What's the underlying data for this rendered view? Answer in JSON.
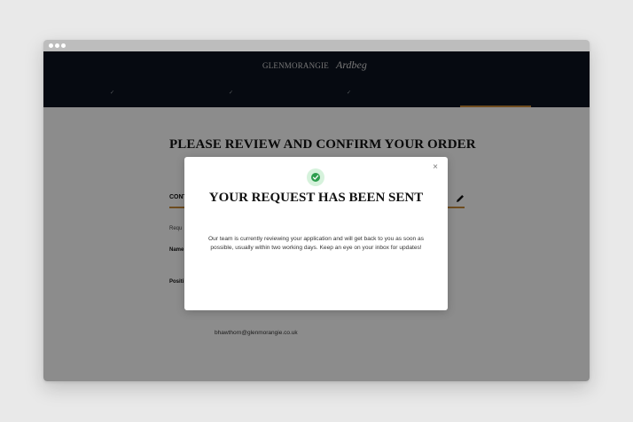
{
  "header": {
    "brand_primary": "GLENMORANGIE",
    "brand_secondary": "Ardbeg",
    "step_check": "✓"
  },
  "page": {
    "title": "PLEASE REVIEW AND CONFIRM YOUR ORDER",
    "section_heading": "CONT",
    "required_text": "Requ",
    "name_label": "Name",
    "position_label": "Positi",
    "email_value": "bhawthorn@glenmorangie.co.uk"
  },
  "modal": {
    "close_label": "×",
    "title": "YOUR REQUEST HAS BEEN SENT",
    "body": "Our team is currently reviewing your application and will get back to you as soon as possible, usually within two working days. Keep an eye on your inbox for updates!"
  },
  "colors": {
    "header_bg": "#0c1320",
    "accent": "#c88b3a",
    "success": "#2e9e4e"
  }
}
